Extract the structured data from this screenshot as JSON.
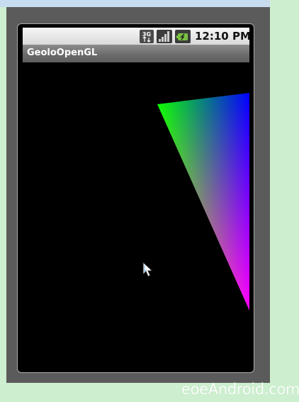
{
  "status_bar": {
    "network_icon": "3g-data-icon",
    "signal_icon": "signal-strength-icon",
    "battery_icon": "battery-charging-icon",
    "time": "12:10 PM"
  },
  "app": {
    "title": "GeoloOpenGL"
  },
  "gl_scene": {
    "shape": "triangle",
    "vertex_colors": [
      "#00ff00",
      "#0000ff",
      "#ff0000"
    ]
  },
  "cursor_icon": "mouse-pointer-icon",
  "watermark": "eoeAndroid.com"
}
